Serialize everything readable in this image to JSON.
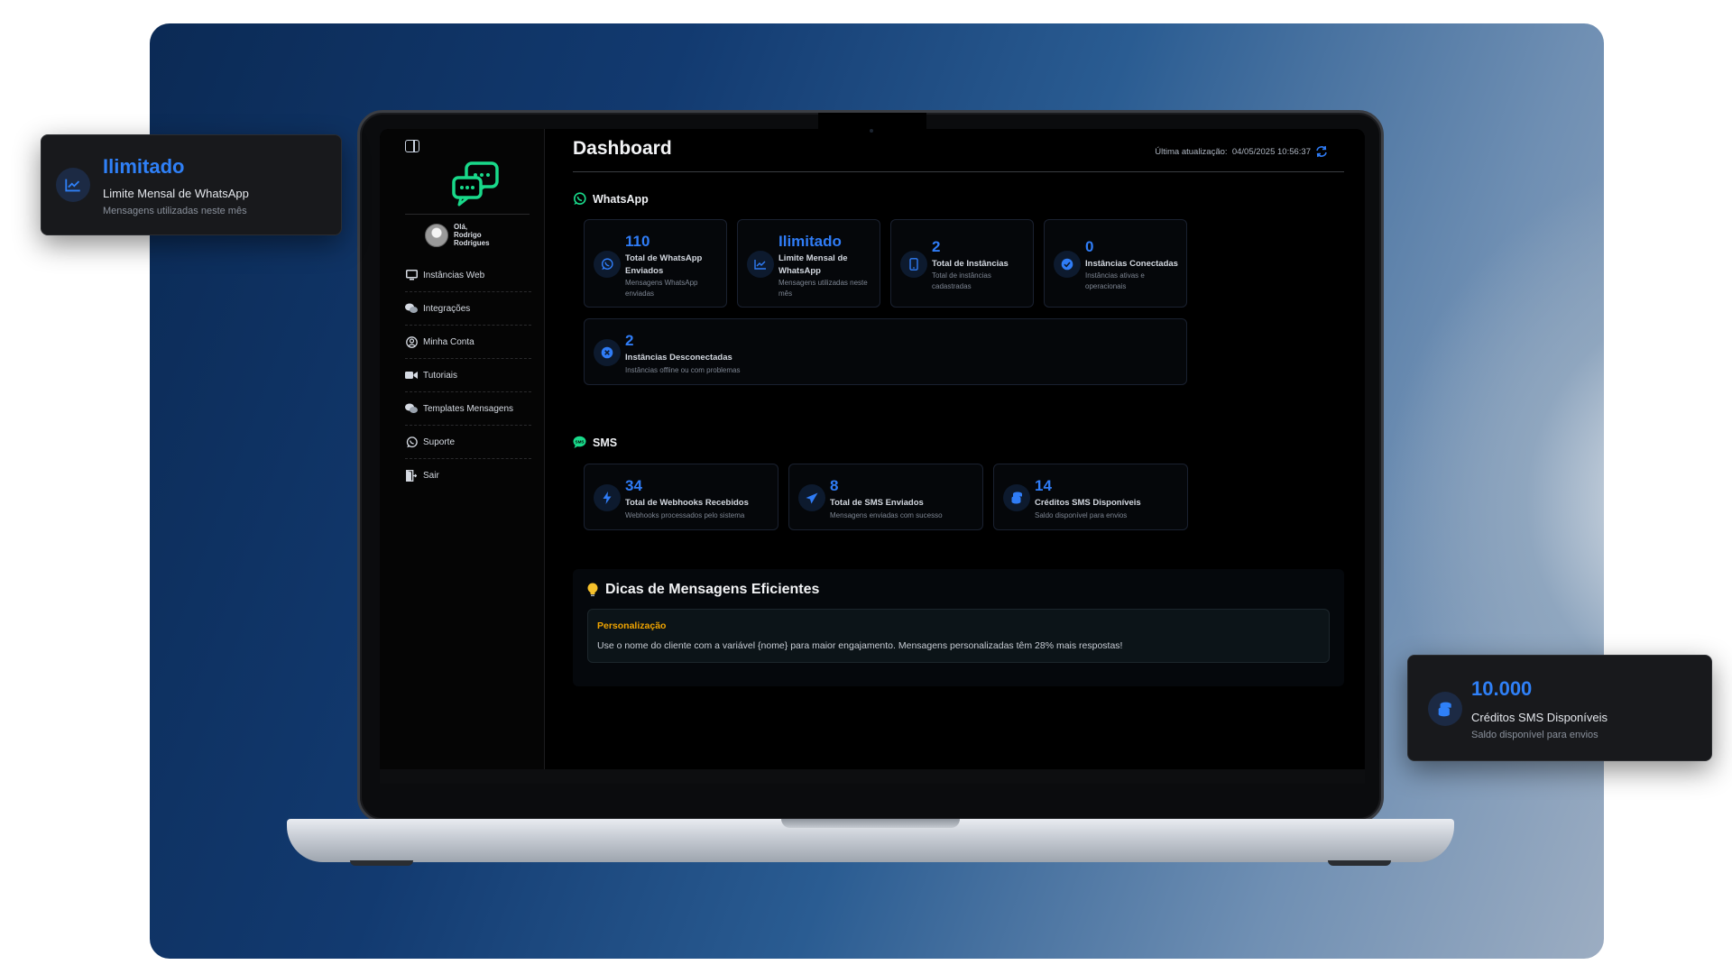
{
  "colors": {
    "accent": "#2f7cf6",
    "brand_green": "#19d98a",
    "warning": "#f0a400"
  },
  "float_left": {
    "value": "Ilimitado",
    "label": "Limite Mensal de WhatsApp",
    "sub": "Mensagens utilizadas neste mês",
    "icon": "chart-line-icon"
  },
  "float_right": {
    "value": "10.000",
    "label": "Créditos SMS Disponíveis",
    "sub": "Saldo disponível para envios",
    "icon": "coins-icon"
  },
  "sidebar": {
    "user_greeting": "Olá,",
    "user_first": "Rodrigo",
    "user_last": "Rodrigues",
    "items": [
      {
        "label": "Instâncias Web",
        "icon": "monitor-icon"
      },
      {
        "label": "Integrações",
        "icon": "chat-bubbles-icon"
      },
      {
        "label": "Minha Conta",
        "icon": "user-circle-icon"
      },
      {
        "label": "Tutoriais",
        "icon": "video-icon"
      },
      {
        "label": "Templates Mensagens",
        "icon": "chat-bubbles-icon"
      },
      {
        "label": "Suporte",
        "icon": "whatsapp-icon"
      },
      {
        "label": "Sair",
        "icon": "door-exit-icon"
      }
    ]
  },
  "header": {
    "title": "Dashboard",
    "update_label": "Última atualização:",
    "update_time": "04/05/2025 10:56:37"
  },
  "whatsapp": {
    "title": "WhatsApp",
    "cards": [
      {
        "value": "110",
        "label": "Total de WhatsApp Enviados",
        "sub": "Mensagens WhatsApp enviadas",
        "icon": "whatsapp-icon"
      },
      {
        "value": "Ilimitado",
        "label": "Limite Mensal de WhatsApp",
        "sub": "Mensagens utilizadas neste mês",
        "icon": "chart-line-icon"
      },
      {
        "value": "2",
        "label": "Total de Instâncias",
        "sub": "Total de instâncias cadastradas",
        "icon": "phone-icon"
      },
      {
        "value": "0",
        "label": "Instâncias Conectadas",
        "sub": "Instâncias ativas e operacionais",
        "icon": "check-circle-icon"
      },
      {
        "value": "2",
        "label": "Instâncias Desconectadas",
        "sub": "Instâncias offline ou com problemas",
        "icon": "x-circle-icon"
      }
    ]
  },
  "sms": {
    "title": "SMS",
    "cards": [
      {
        "value": "34",
        "label": "Total de Webhooks Recebidos",
        "sub": "Webhooks processados pelo sistema",
        "icon": "bolt-icon"
      },
      {
        "value": "8",
        "label": "Total de SMS Enviados",
        "sub": "Mensagens enviadas com sucesso",
        "icon": "paper-plane-icon"
      },
      {
        "value": "14",
        "label": "Créditos SMS Disponíveis",
        "sub": "Saldo disponível para envios",
        "icon": "coins-icon"
      }
    ]
  },
  "tips": {
    "title": "Dicas de Mensagens Eficientes",
    "item_title": "Personalização",
    "item_text": "Use o nome do cliente com a variável {nome} para maior engajamento. Mensagens personalizadas têm 28% mais respostas!"
  }
}
